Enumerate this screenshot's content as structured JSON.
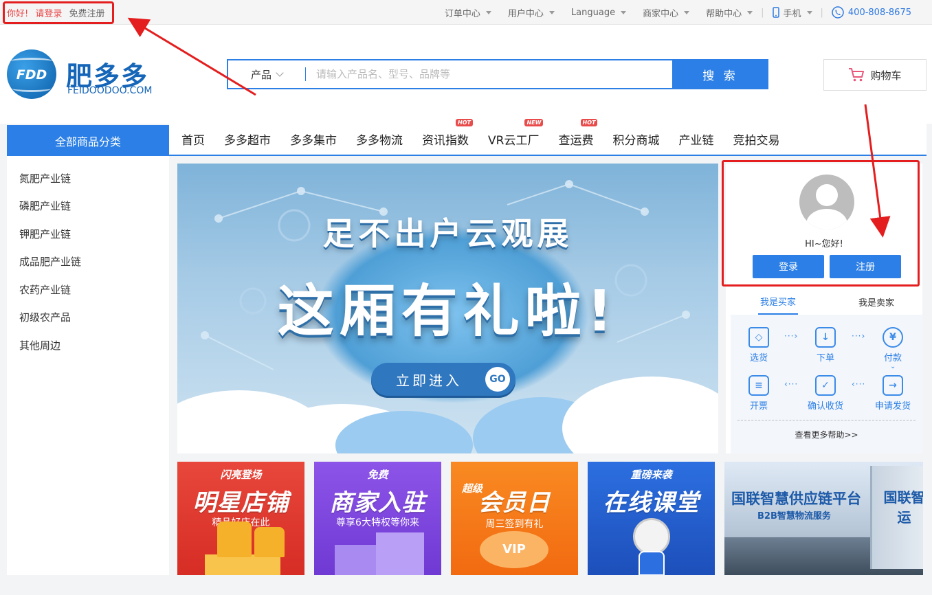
{
  "topbar": {
    "greeting": "你好!",
    "login": "请登录",
    "register": "免费注册",
    "links": [
      "订单中心",
      "用户中心",
      "Language",
      "商家中心",
      "帮助中心"
    ],
    "mobile": "手机",
    "phone": "400-808-8675"
  },
  "logo": {
    "mark": "FDD",
    "name_cn": "肥多多",
    "name_en": "FEIDOODOO.COM"
  },
  "search": {
    "category": "产品",
    "placeholder": "请输入产品名、型号、品牌等",
    "button": "搜 索"
  },
  "cart": {
    "label": "购物车"
  },
  "nav": {
    "all_categories": "全部商品分类",
    "items": [
      {
        "label": "首页",
        "badge": ""
      },
      {
        "label": "多多超市",
        "badge": ""
      },
      {
        "label": "多多集市",
        "badge": ""
      },
      {
        "label": "多多物流",
        "badge": ""
      },
      {
        "label": "资讯指数",
        "badge": "HOT"
      },
      {
        "label": "VR云工厂",
        "badge": "NEW"
      },
      {
        "label": "查运费",
        "badge": "HOT"
      },
      {
        "label": "积分商城",
        "badge": ""
      },
      {
        "label": "产业链",
        "badge": ""
      },
      {
        "label": "竞拍交易",
        "badge": ""
      }
    ]
  },
  "categories": [
    "氮肥产业链",
    "磷肥产业链",
    "钾肥产业链",
    "成品肥产业链",
    "农药产业链",
    "初级农产品",
    "其他周边"
  ],
  "banner": {
    "line1": "足不出户云观展",
    "line2": "这厢有礼啦!",
    "cta": "立即进入",
    "cta_icon": "GO"
  },
  "user_panel": {
    "greeting": "HI~您好!",
    "login": "登录",
    "register": "注册",
    "tab_buyer": "我是买家",
    "tab_seller": "我是卖家",
    "steps": [
      "选货",
      "下单",
      "付款",
      "开票",
      "确认收货",
      "申请发货"
    ],
    "more_help": "查看更多帮助>>"
  },
  "promos": [
    {
      "tag": "闪亮登场",
      "title": "明星店铺",
      "subtitle": "精品好店在此"
    },
    {
      "tag": "免费",
      "title": "商家入驻",
      "subtitle": "尊享6大特权等你来"
    },
    {
      "tag": "超级",
      "title": "会员日",
      "subtitle": "周三签到有礼"
    },
    {
      "tag": "重磅来袭",
      "title": "在线课堂",
      "subtitle": ""
    },
    {
      "tag": "",
      "title": "国联智慧供应链平台",
      "subtitle": "B2B智慧物流服务",
      "truck": "国联智运"
    }
  ],
  "colors": {
    "primary": "#2b7fe6",
    "accent_red": "#e94b4b",
    "annotation": "#e41e1e"
  }
}
